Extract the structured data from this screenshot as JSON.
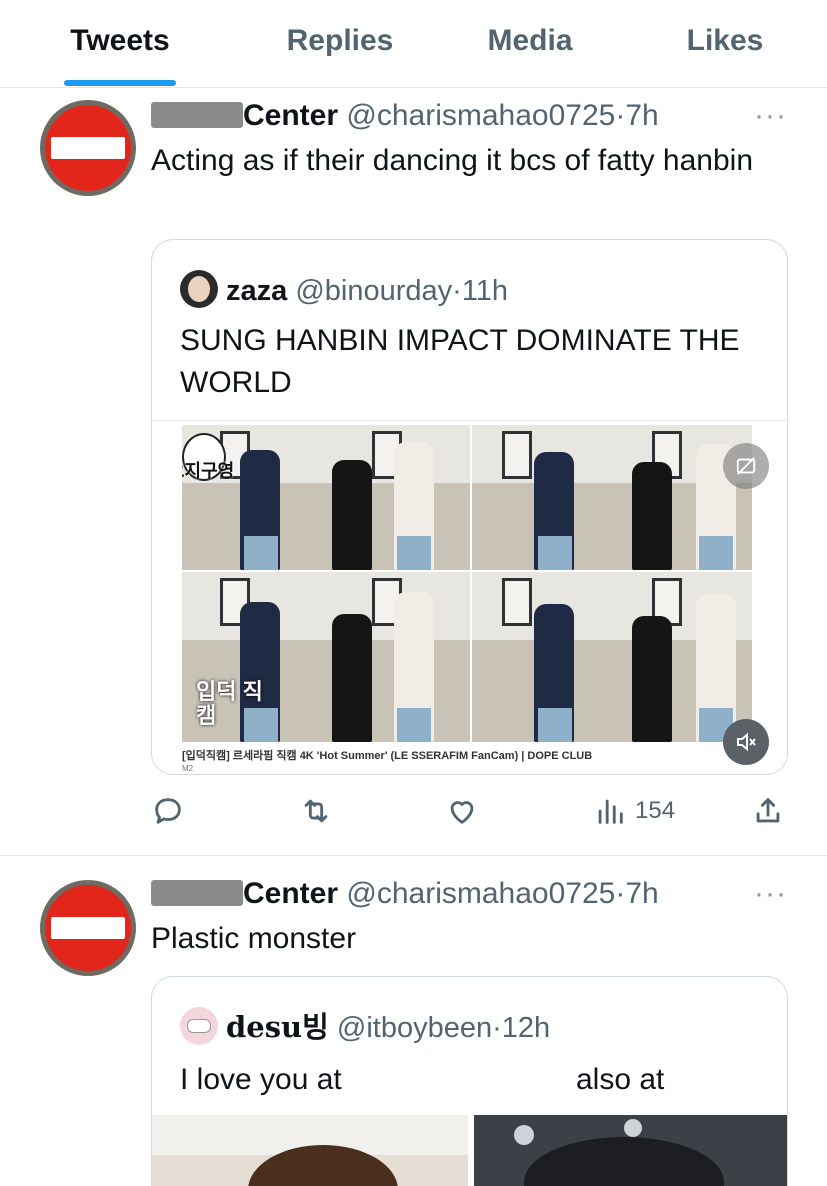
{
  "tabs": [
    {
      "label": "Tweets",
      "active": true
    },
    {
      "label": "Replies",
      "active": false
    },
    {
      "label": "Media",
      "active": false
    },
    {
      "label": "Likes",
      "active": false
    }
  ],
  "tweets": [
    {
      "name": "Center",
      "handle": "@charismahao0725",
      "separator": "·",
      "time": "7h",
      "more": "···",
      "text": "Acting as if their dancing it bcs of fatty hanbin",
      "quote": {
        "name": "zaza",
        "handle": "@binourday",
        "time": "11h",
        "text": "SUNG HANBIN IMPACT DOMINATE THE WORLD",
        "video_caption": "[입덕직캠] 르세라핌 직캠 4K 'Hot Summer' (LE SSERAFIM FanCam) | DOPE CLUB",
        "video_channel": "M2",
        "overlay_logo": "오지구영",
        "overlay_corner": "입덕 직캠"
      },
      "actions": {
        "reply": "",
        "retweet": "",
        "like": "",
        "views": "154",
        "share": ""
      }
    },
    {
      "name": "Center",
      "handle": "@charismahao0725",
      "separator": "·",
      "time": "7h",
      "more": "···",
      "text": "Plastic monster",
      "quote": {
        "name": "desu빙",
        "handle": "@itboybeen",
        "time": "12h",
        "text_left": "I love you at",
        "text_right": "also at"
      }
    }
  ],
  "colors": {
    "accent": "#1d9bf0",
    "secondary_text": "#536471",
    "border": "#cfd9de"
  },
  "icons": [
    "reply-icon",
    "retweet-icon",
    "like-icon",
    "views-icon",
    "share-icon",
    "mute-icon",
    "captions-off-icon",
    "more-icon"
  ]
}
